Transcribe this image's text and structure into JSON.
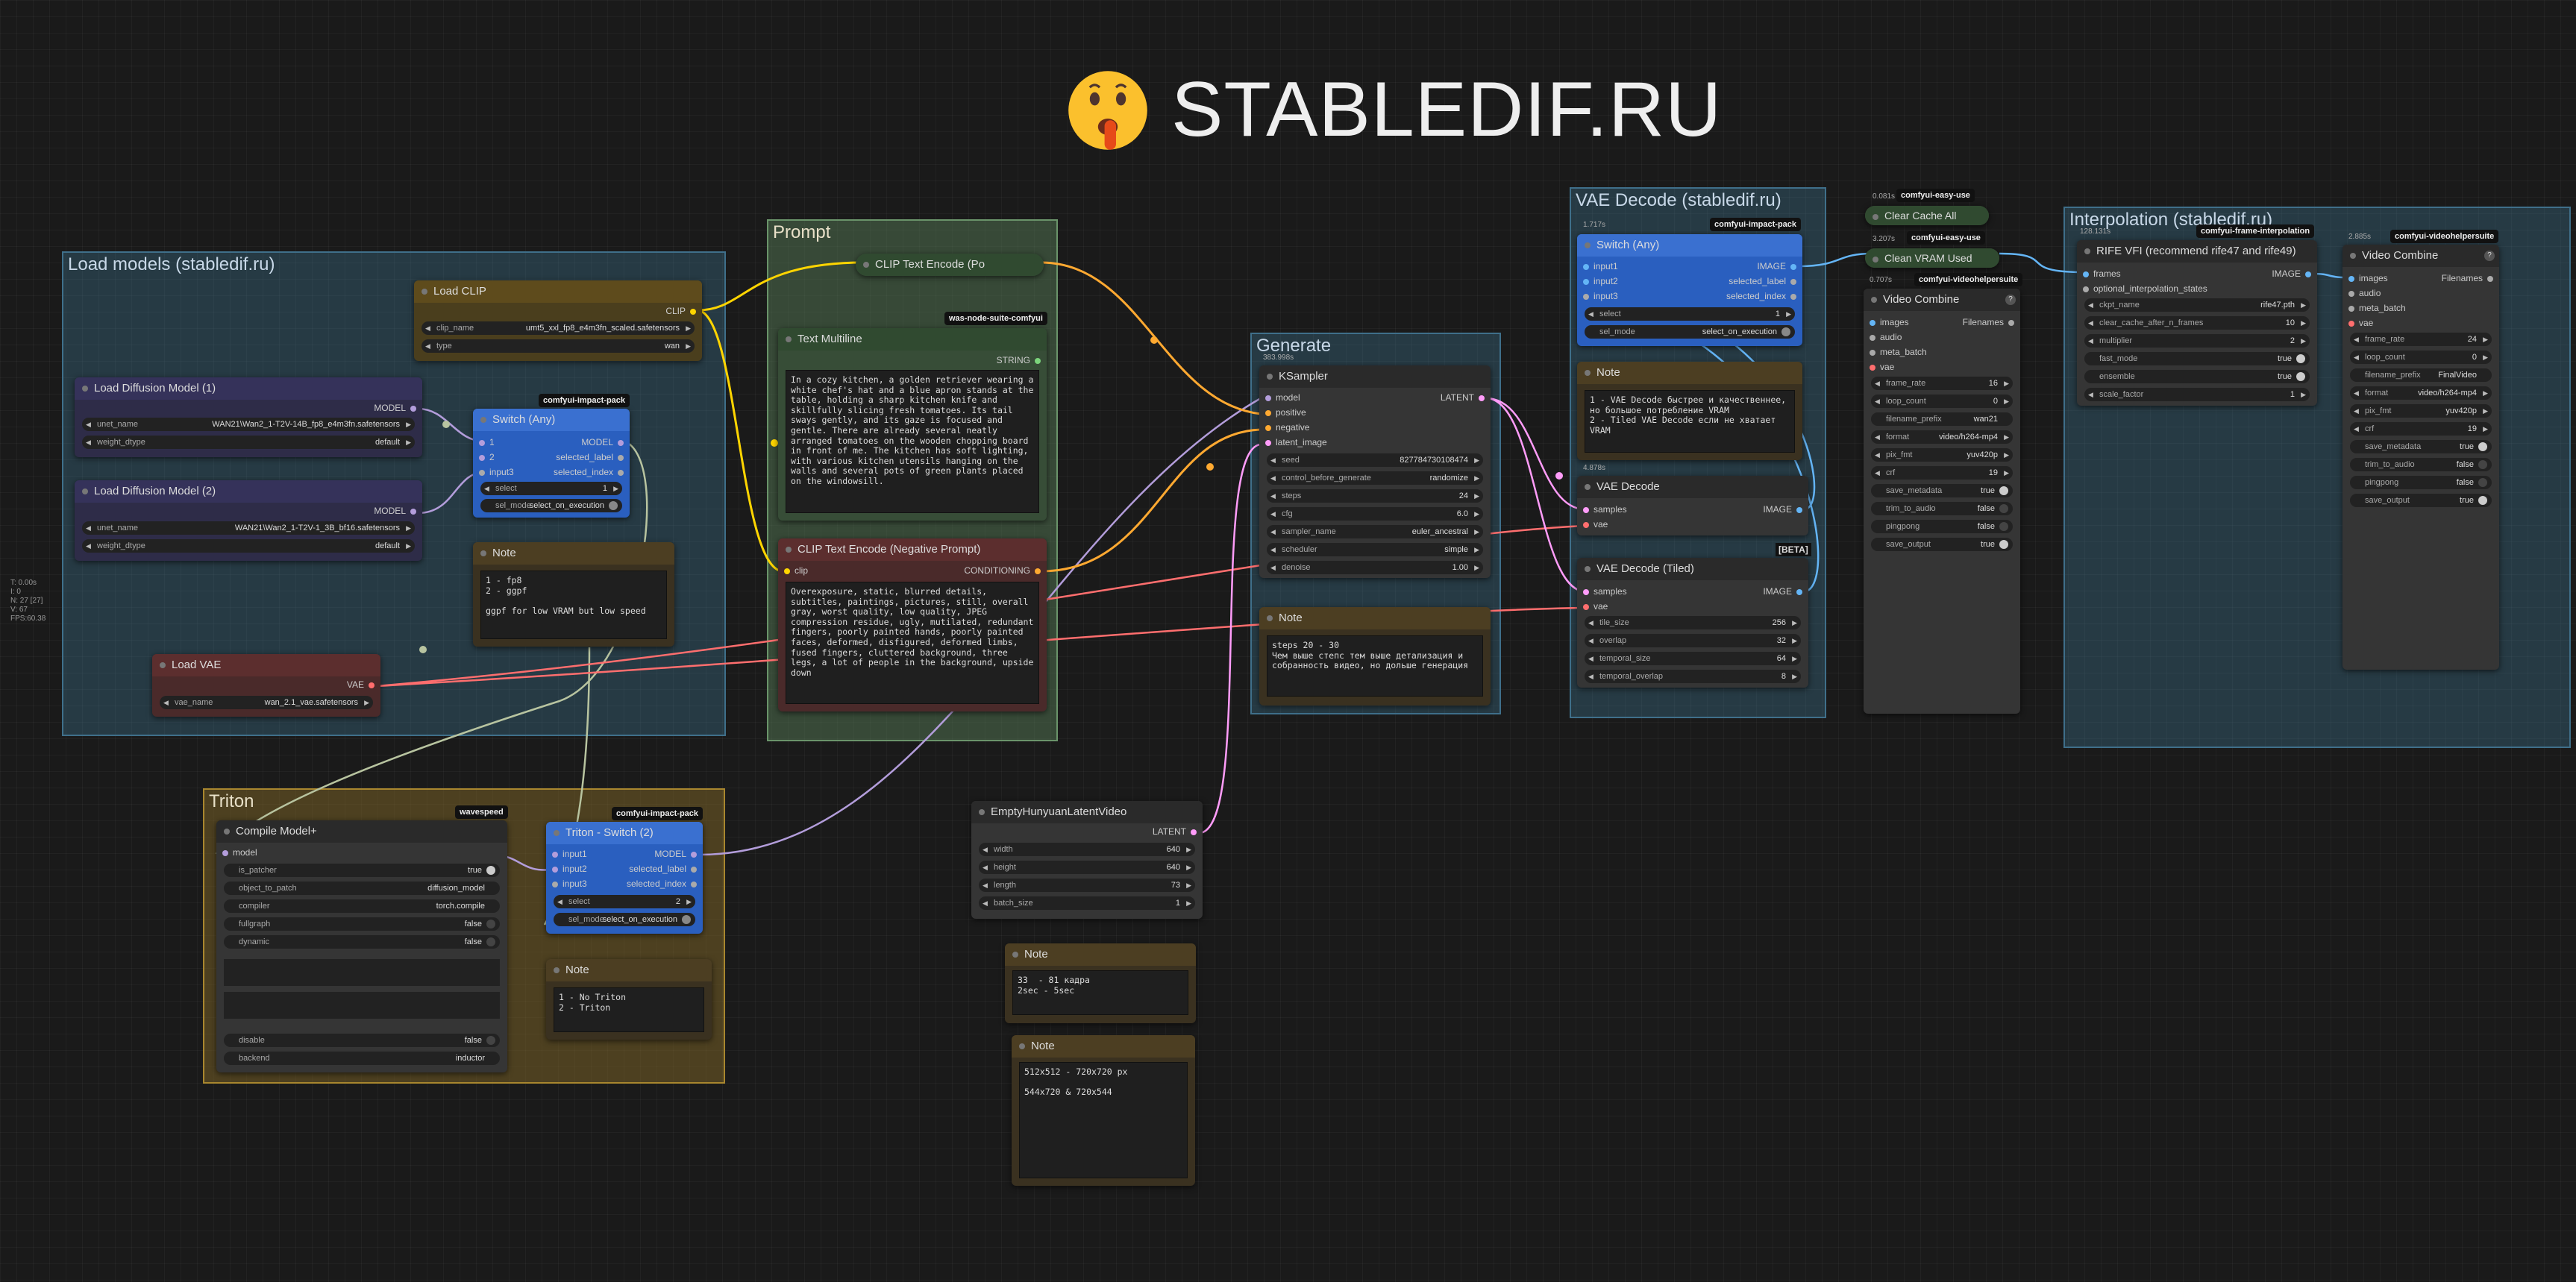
{
  "brand": {
    "title": "STABLEDIF.RU",
    "icon": "shushing-face-emoji"
  },
  "stats": [
    "T: 0.00s",
    "I: 0",
    "N: 27 [27]",
    "V: 67",
    "FPS:60.38"
  ],
  "colors": {
    "clip": "#ffd500",
    "model": "#b39ddb",
    "vae": "#ff6e6e",
    "conditioning": "#ffa931",
    "latent": "#ff9cf9",
    "image": "#64b5f6",
    "string": "#7cd47c"
  },
  "groups": {
    "load": "Load models (stabledif.ru)",
    "prompt": "Prompt",
    "generate": "Generate",
    "vae": "VAE Decode (stabledif.ru)",
    "interp": "Interpolation (stabledif.ru)",
    "triton": "Triton"
  },
  "badges": {
    "impact1": "comfyui-impact-pack",
    "impact2": "comfyui-impact-pack",
    "impact3": "comfyui-impact-pack",
    "wasmode": "was-node-suite-comfyui",
    "wavespeed": "wavespeed",
    "easy1": "comfyui-easy-use",
    "easy2": "comfyui-easy-use",
    "vhs1": "comfyui-videohelpersuite",
    "vhs2": "comfyui-videohelpersuite",
    "frameinterp": "comfyui-frame-interpolation",
    "beta": "[BETA]"
  },
  "timings": {
    "t1": "1.717s",
    "t2": "383.998s",
    "t3": "4.878s",
    "t4": "0.081s",
    "t5": "3.207s",
    "t6": "0.707s",
    "t7": "128.131s",
    "t8": "2.885s"
  },
  "load_clip": {
    "title": "Load CLIP",
    "out": "CLIP",
    "clip_name_label": "clip_name",
    "clip_name": "umt5_xxl_fp8_e4m3fn_scaled.safetensors",
    "type_label": "type",
    "type": "wan"
  },
  "ldm1": {
    "title": "Load Diffusion Model (1)",
    "out": "MODEL",
    "unet_label": "unet_name",
    "unet": "WAN21\\Wan2_1-T2V-14B_fp8_e4m3fn.safetensors",
    "dtype_label": "weight_dtype",
    "dtype": "default"
  },
  "ldm2": {
    "title": "Load Diffusion Model (2)",
    "out": "MODEL",
    "unet_label": "unet_name",
    "unet": "WAN21\\Wan2_1-T2V-1_3B_bf16.safetensors",
    "dtype_label": "weight_dtype",
    "dtype": "default"
  },
  "switch1": {
    "title": "Switch (Any)",
    "in1": "1",
    "in2": "2",
    "in3": "input3",
    "out1": "MODEL",
    "out2": "selected_label",
    "out3": "selected_index",
    "select_label": "select",
    "select": "1",
    "selmode_label": "sel_mode",
    "selmode": "select_on_execution"
  },
  "note1": {
    "title": "Note",
    "text": "1 - fp8\n2 - ggpf\n\nggpf for low VRAM but low speed"
  },
  "load_vae": {
    "title": "Load VAE",
    "out": "VAE",
    "vae_label": "vae_name",
    "vae": "wan_2.1_vae.safetensors"
  },
  "clip_pos": {
    "title": "CLIP Text Encode (Po"
  },
  "text_multi": {
    "title": "Text Multiline",
    "out": "STRING",
    "text": "In a cozy kitchen, a golden retriever wearing a white chef's hat and a blue apron stands at the table, holding a sharp kitchen knife and skillfully slicing fresh tomatoes. Its tail sways gently, and its gaze is focused and gentle. There are already several neatly arranged tomatoes on the wooden chopping board in front of me. The kitchen has soft lighting, with various kitchen utensils hanging on the walls and several pots of green plants placed on the windowsill."
  },
  "clip_neg": {
    "title": "CLIP Text Encode (Negative Prompt)",
    "in": "clip",
    "out": "CONDITIONING",
    "text": "Overexposure, static, blurred details, subtitles, paintings, pictures, still, overall gray, worst quality, low quality, JPEG compression residue, ugly, mutilated, redundant fingers, poorly painted hands, poorly painted faces, deformed, disfigured, deformed limbs, fused fingers, cluttered background, three legs, a lot of people in the background, upside down"
  },
  "ksampler": {
    "title": "KSampler",
    "inputs": [
      "model",
      "positive",
      "negative",
      "latent_image"
    ],
    "out": "LATENT",
    "widgets": [
      [
        "seed",
        "827784730108474"
      ],
      [
        "control_before_generate",
        "randomize"
      ],
      [
        "steps",
        "24"
      ],
      [
        "cfg",
        "6.0"
      ],
      [
        "sampler_name",
        "euler_ancestral"
      ],
      [
        "scheduler",
        "simple"
      ],
      [
        "denoise",
        "1.00"
      ]
    ]
  },
  "note_steps": {
    "title": "Note",
    "text": "steps 20 - 30\nЧем выше степс тем выше детализация и собранность видео, но дольше генерация"
  },
  "latent": {
    "title": "EmptyHunyuanLatentVideo",
    "out": "LATENT",
    "widgets": [
      [
        "width",
        "640"
      ],
      [
        "height",
        "640"
      ],
      [
        "length",
        "73"
      ],
      [
        "batch_size",
        "1"
      ]
    ]
  },
  "note_frames": {
    "title": "Note",
    "text": "33  - 81 кадра\n2sec - 5sec"
  },
  "note_res": {
    "title": "Note",
    "text": "512x512 - 720x720 px\n\n544x720 & 720x544"
  },
  "compile": {
    "title": "Compile Model+",
    "in": "model",
    "widgets": [
      [
        "is_patcher",
        "true"
      ],
      [
        "object_to_patch",
        "diffusion_model"
      ],
      [
        "compiler",
        "torch.compile"
      ],
      [
        "fullgraph",
        "false"
      ],
      [
        "dynamic",
        "false"
      ]
    ],
    "disable_label": "disable",
    "disable": "false",
    "backend_label": "backend",
    "backend": "inductor"
  },
  "switch2": {
    "title": "Triton - Switch (2)",
    "in1": "input1",
    "in2": "input2",
    "in3": "input3",
    "out1": "MODEL",
    "out2": "selected_label",
    "out3": "selected_index",
    "select_label": "select",
    "select": "2",
    "selmode_label": "sel_mode",
    "selmode": "select_on_execution"
  },
  "note_triton": {
    "title": "Note",
    "text": "1 - No Triton\n2 - Triton"
  },
  "switch3": {
    "title": "Switch (Any)",
    "in1": "input1",
    "in2": "input2",
    "in3": "input3",
    "out1": "IMAGE",
    "out2": "selected_label",
    "out3": "selected_index",
    "select_label": "select",
    "select": "1",
    "selmode_label": "sel_mode",
    "selmode": "select_on_execution"
  },
  "note_vae": {
    "title": "Note",
    "text": "1 - VAE Decode быстрее и качественнее, но большое потребление VRAM\n2 - Tiled VAE Decode если не хватает VRAM"
  },
  "vae_decode": {
    "title": "VAE Decode",
    "in1": "samples",
    "in2": "vae",
    "out": "IMAGE"
  },
  "vae_tiled": {
    "title": "VAE Decode (Tiled)",
    "in1": "samples",
    "in2": "vae",
    "out": "IMAGE",
    "widgets": [
      [
        "tile_size",
        "256"
      ],
      [
        "overlap",
        "32"
      ],
      [
        "temporal_size",
        "64"
      ],
      [
        "temporal_overlap",
        "8"
      ]
    ]
  },
  "clear_cache": {
    "label": "Clear Cache All"
  },
  "clean_vram": {
    "label": "Clean VRAM Used"
  },
  "vc1": {
    "title": "Video Combine",
    "inputs": [
      "images",
      "audio",
      "meta_batch",
      "vae"
    ],
    "out": "Filenames",
    "widgets": [
      [
        "frame_rate",
        "16"
      ],
      [
        "loop_count",
        "0"
      ],
      [
        "filename_prefix",
        "wan21"
      ],
      [
        "format",
        "video/h264-mp4"
      ],
      [
        "pix_fmt",
        "yuv420p"
      ],
      [
        "crf",
        "19"
      ],
      [
        "save_metadata",
        "true"
      ],
      [
        "trim_to_audio",
        "false"
      ],
      [
        "pingpong",
        "false"
      ],
      [
        "save_output",
        "true"
      ]
    ]
  },
  "rife": {
    "title": "RIFE VFI (recommend rife47 and rife49)",
    "in1": "frames",
    "in2": "optional_interpolation_states",
    "out": "IMAGE",
    "widgets": [
      [
        "ckpt_name",
        "rife47.pth"
      ],
      [
        "clear_cache_after_n_frames",
        "10"
      ],
      [
        "multiplier",
        "2"
      ],
      [
        "fast_mode",
        "true"
      ],
      [
        "ensemble",
        "true"
      ],
      [
        "scale_factor",
        "1"
      ]
    ]
  },
  "vc2": {
    "title": "Video Combine",
    "inputs": [
      "images",
      "audio",
      "meta_batch",
      "vae"
    ],
    "out": "Filenames",
    "widgets": [
      [
        "frame_rate",
        "24"
      ],
      [
        "loop_count",
        "0"
      ],
      [
        "filename_prefix",
        "FinalVideo"
      ],
      [
        "format",
        "video/h264-mp4"
      ],
      [
        "pix_fmt",
        "yuv420p"
      ],
      [
        "crf",
        "19"
      ],
      [
        "save_metadata",
        "true"
      ],
      [
        "trim_to_audio",
        "false"
      ],
      [
        "pingpong",
        "false"
      ],
      [
        "save_output",
        "true"
      ]
    ]
  }
}
